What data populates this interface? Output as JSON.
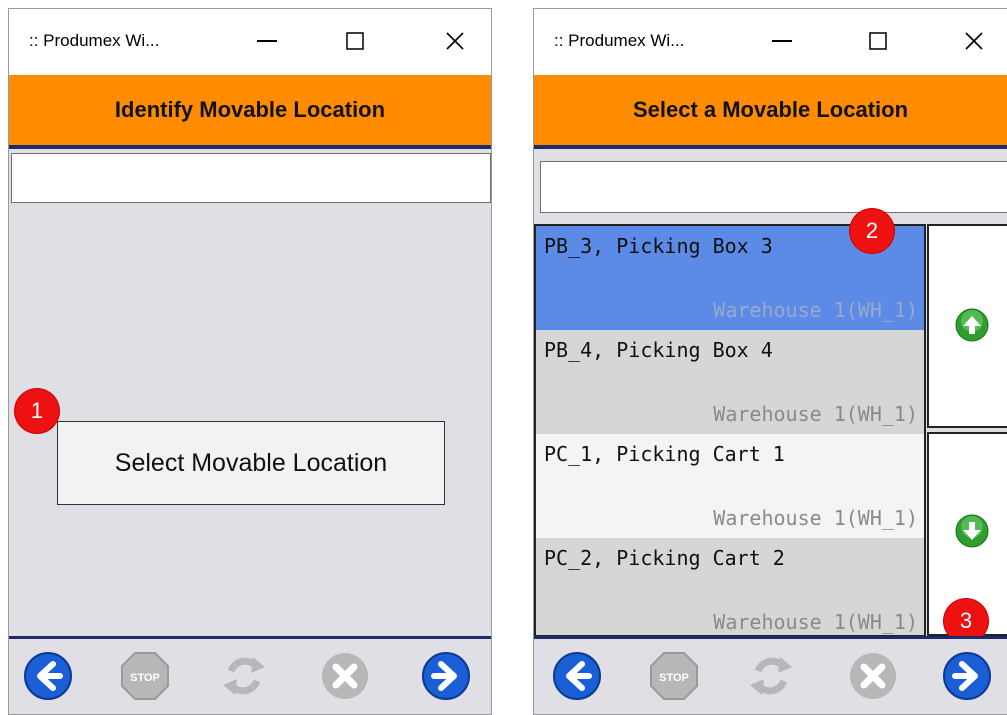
{
  "left_window": {
    "title": ":: Produmex Wi...",
    "header": "Identify Movable Location",
    "input_value": "",
    "select_button_label": "Select Movable Location",
    "badge": "1"
  },
  "right_window": {
    "title": ":: Produmex Wi...",
    "header": "Select a Movable Location",
    "input_value": "",
    "items": [
      {
        "name": "PB_3, Picking Box 3",
        "warehouse": "Warehouse 1(WH_1)",
        "selected": true
      },
      {
        "name": "PB_4, Picking Box 4",
        "warehouse": "Warehouse 1(WH_1)",
        "selected": false
      },
      {
        "name": "PC_1, Picking Cart 1",
        "warehouse": "Warehouse 1(WH_1)",
        "selected": false
      },
      {
        "name": "PC_2, Picking Cart 2",
        "warehouse": "Warehouse 1(WH_1)",
        "selected": false
      }
    ],
    "badge_list": "2",
    "badge_next": "3"
  },
  "icons": {
    "back": "back-arrow-icon",
    "stop": "stop-icon",
    "refresh": "refresh-icon",
    "cancel": "cancel-icon",
    "next": "next-arrow-icon",
    "scroll_up": "scroll-up-icon",
    "scroll_down": "scroll-down-icon"
  },
  "stop_label": "STOP",
  "colors": {
    "header": "#ff8c00",
    "selected_item": "#5b8be6",
    "badge": "#ee1111",
    "nav_blue": "#1a5fd6"
  }
}
